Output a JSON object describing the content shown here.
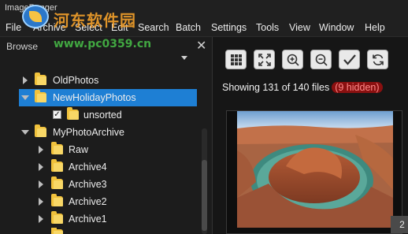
{
  "app": {
    "title": "ImageRanger"
  },
  "watermark": {
    "site_name": "河东软件园",
    "url": "www.pc0359.cn"
  },
  "menu": {
    "items": [
      "File",
      "Archive",
      "Select",
      "Edit",
      "Search",
      "Batch",
      "Settings",
      "Tools",
      "View",
      "Window",
      "Help"
    ]
  },
  "browse_panel": {
    "title": "Browse",
    "close_icon": "close-icon",
    "tree": [
      {
        "label": "OldPhotos",
        "expanded": false,
        "selected": false
      },
      {
        "label": "NewHolidayPhotos",
        "expanded": true,
        "selected": true
      },
      {
        "label": "unsorted",
        "checked": true
      },
      {
        "label": "MyPhotoArchive",
        "expanded": true
      },
      {
        "label": "Raw",
        "expanded": false
      },
      {
        "label": "Archive4",
        "expanded": false
      },
      {
        "label": "Archive3",
        "expanded": false
      },
      {
        "label": "Archive2",
        "expanded": false
      },
      {
        "label": "Archive1",
        "expanded": false
      }
    ]
  },
  "toolbar": {
    "buttons": [
      "grid-icon",
      "fit-icon",
      "zoom-in-icon",
      "zoom-out-icon",
      "checkmark-icon",
      "refresh-icon"
    ]
  },
  "status": {
    "text": "Showing 131 of 140 files",
    "hidden": "(9 hidden)"
  },
  "preview": {
    "page_number": "2"
  },
  "colors": {
    "selection": "#1e7fd4",
    "hidden_badge_bg": "#8a1010",
    "hidden_badge_text": "#ff8a8a",
    "folder": "#f1c23c"
  }
}
